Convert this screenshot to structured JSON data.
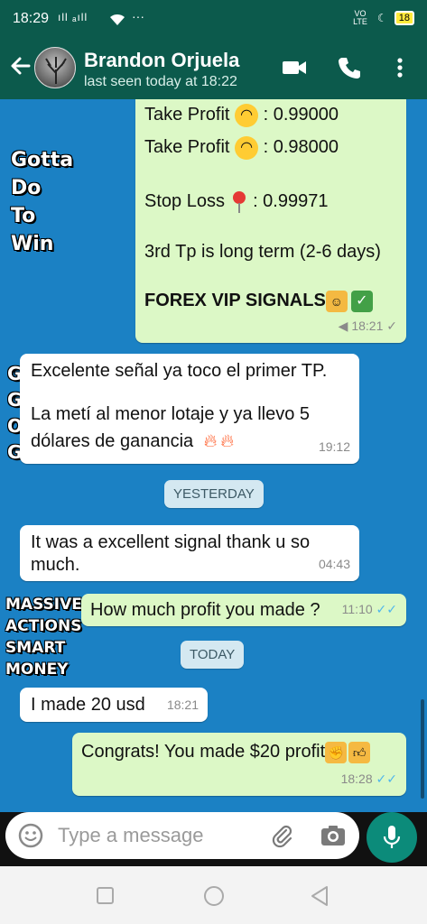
{
  "status_bar": {
    "time": "18:29",
    "signal_text": "ıll ₐıll",
    "net_label": "VO LTE",
    "battery": "18"
  },
  "header": {
    "contact_name": "Brandon Orjuela",
    "last_seen": "last seen today at 18:22"
  },
  "watermarks": {
    "gotta": [
      "Gotta",
      "Do",
      "To",
      "Win"
    ],
    "massive": [
      "MASSIVE",
      "ACTIONS",
      "SMART",
      "MONEY"
    ],
    "g_letters": [
      "G",
      "G",
      "O",
      "G"
    ]
  },
  "messages": {
    "signal": {
      "tp2_label": "Take Profit",
      "tp2_value": " : 0.99000",
      "tp3_label": "Take Profit",
      "tp3_value": " : 0.98000",
      "sl_label": "Stop Loss",
      "sl_value": " : 0.99971",
      "note": "3rd Tp is long term (2-6 days)",
      "brand": "FOREX VIP SIGNALS",
      "time": "18:21"
    },
    "excelente": {
      "line1": "Excelente señal ya toco el primer TP.",
      "line2": "La metí al menor lotaje y ya llevo 5",
      "line3": "dólares de ganancia",
      "time": "19:12"
    },
    "yesterday": "YESTERDAY",
    "excellent": {
      "line1": "It was a excellent signal thank u so",
      "line2": "much.",
      "time": "04:43"
    },
    "how_much": {
      "text": "How much profit you made ?",
      "time": "11:10"
    },
    "today": "TODAY",
    "made20": {
      "text": "I made 20 usd",
      "time": "18:21"
    },
    "congrats": {
      "text": "Congrats! You made $20 profit",
      "time": "18:28"
    }
  },
  "input": {
    "placeholder": "Type a message"
  },
  "colors": {
    "header": "#0c5a4c",
    "chat_bg": "#1b81c4",
    "outgoing": "#dcf8c6",
    "incoming": "#ffffff",
    "read_ticks": "#4fb6ec",
    "mic_button": "#0c8b7a"
  }
}
